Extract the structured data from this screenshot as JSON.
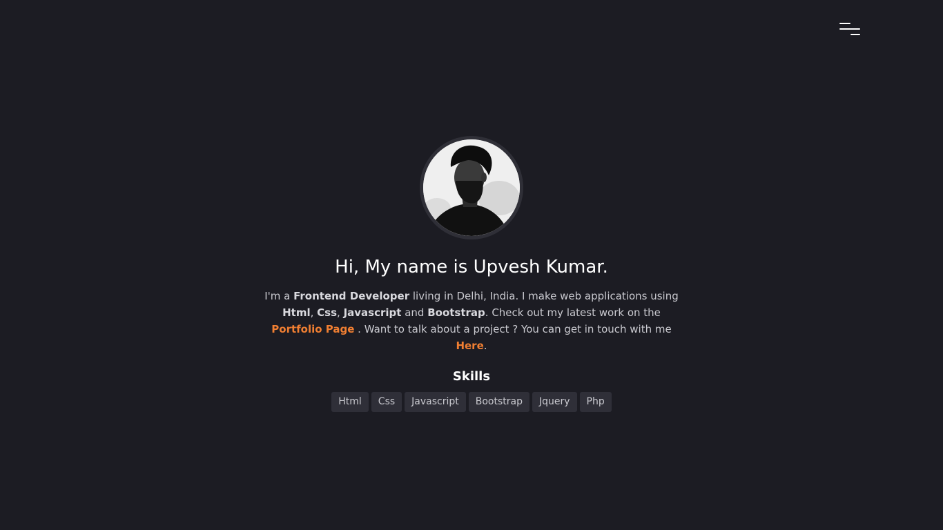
{
  "nav": {
    "menu_icon": "hamburger-menu-icon"
  },
  "profile": {
    "avatar_icon": "profile-photo",
    "title": "Hi, My name is Upvesh Kumar.",
    "intro": {
      "p1": "I'm a ",
      "role": "Frontend Developer",
      "p2": " living in Delhi, India. I make web applications using ",
      "skill1": "Html",
      "p3": ", ",
      "skill2": "Css",
      "p4": ", ",
      "skill3": "Javascript",
      "p5": " and ",
      "skill4": "Bootstrap",
      "p6": ". Check out my latest work on the ",
      "portfolio_link": "Portfolio Page",
      "p7": " . Want to talk about a project ? You can get in touch with me ",
      "contact_link": "Here",
      "p8": "."
    }
  },
  "skills": {
    "title": "Skills",
    "items": [
      "Html",
      "Css",
      "Javascript",
      "Bootstrap",
      "Jquery",
      "Php"
    ]
  },
  "colors": {
    "background": "#1c1c23",
    "accent": "#f17f32",
    "tag_bg": "#2f2f38"
  }
}
